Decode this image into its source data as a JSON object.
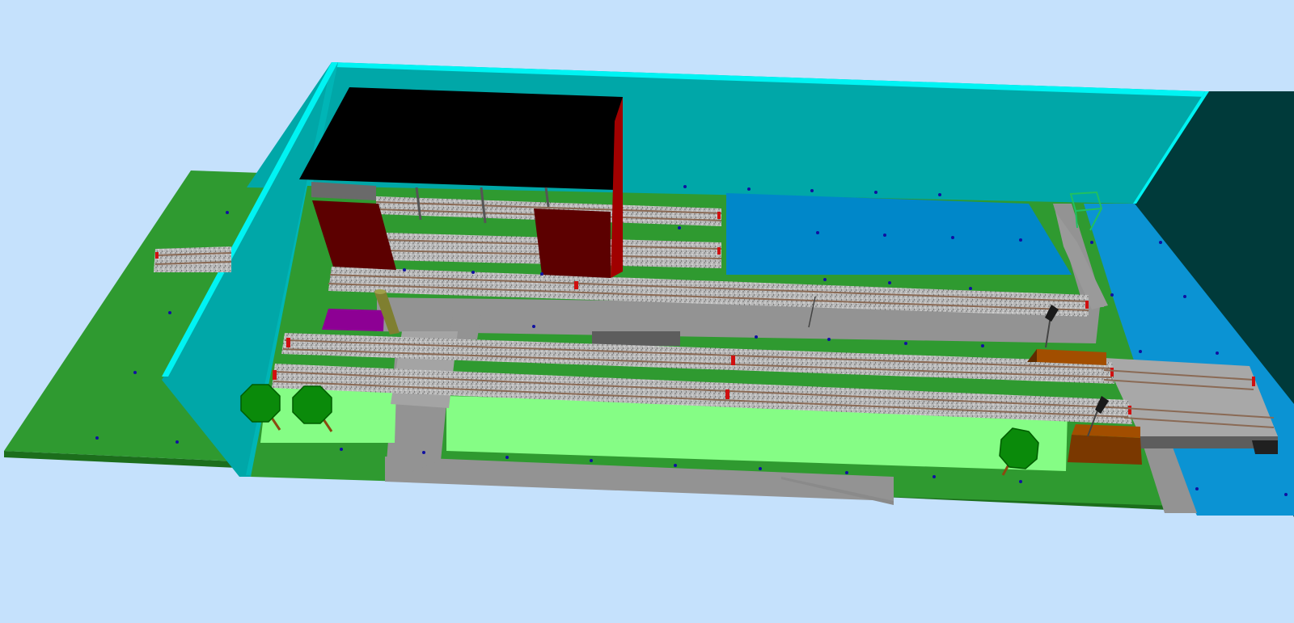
{
  "viewport": {
    "kind": "3d-model-railway-layout-view",
    "background": "#c5e1fc"
  },
  "colors": {
    "grass": "#2f9a30",
    "grass_edge": "#1c6e1c",
    "wall": "#00a7a8",
    "wall_top": "#00f5f5",
    "wall_dark": "#003a3a",
    "water": "#0087c9",
    "water_light": "#0b93d3",
    "road": "#939393",
    "road_dark": "#5d5d5d",
    "platform": "#85fd85",
    "ballast": "#b5b5b5",
    "rail": "#8a6a55",
    "roof": "#000000",
    "building_wall": "#5c0000",
    "building_side": "#a00000",
    "purple_box": "#8d0094",
    "orange_box": "#a24e00",
    "orange_box_dark": "#5f2d00",
    "tree": "#0a8a0a",
    "tree_dark": "#005c00",
    "trunk": "#8a4a10",
    "pole": "#8a8a3a",
    "signal": "#1a1a1a",
    "buffer_red": "#d01010",
    "marker_dot": "#1010a0",
    "frame_green": "#20c060"
  },
  "objects": {
    "tracks": [
      "upper-siding-1",
      "upper-siding-2",
      "middle-through-track",
      "lower-main-track-1",
      "lower-main-track-2",
      "left-stub-track"
    ],
    "buildings": [
      "engine-shed"
    ],
    "trees": [
      "tree-1",
      "tree-2",
      "tree-3"
    ],
    "signals": [
      "signal-1",
      "signal-2"
    ]
  }
}
